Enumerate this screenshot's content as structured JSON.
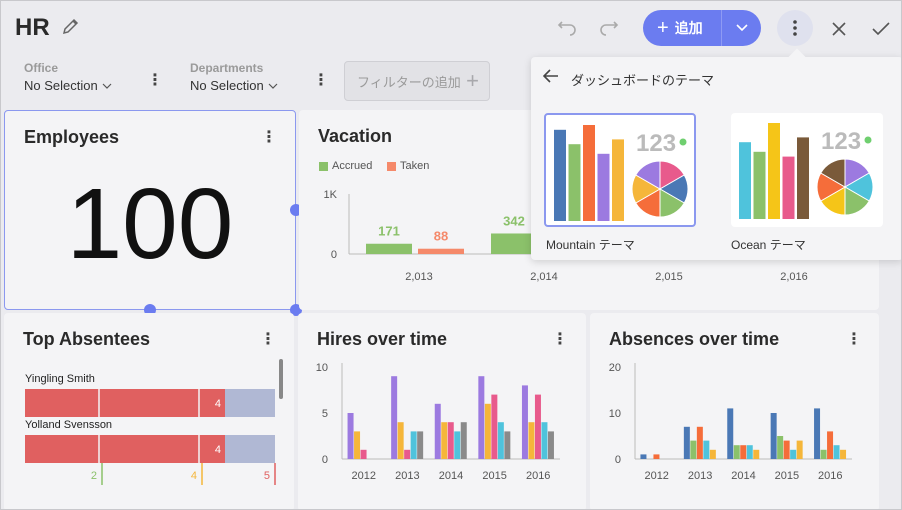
{
  "header": {
    "title": "HR",
    "add_label": "追加"
  },
  "filters": [
    {
      "label": "Office",
      "value": "No Selection"
    },
    {
      "label": "Departments",
      "value": "No Selection"
    }
  ],
  "add_filter_label": "フィルターの追加",
  "theme_popover": {
    "title": "ダッシュボードのテーマ",
    "themes": [
      {
        "name": "Mountain テーマ",
        "number": "123",
        "selected": true,
        "bar_colors": [
          "#4a78b5",
          "#8bc16a",
          "#f56d3a",
          "#9c7ae0",
          "#f5b63a"
        ],
        "bar_values": [
          0.95,
          0.8,
          1.0,
          0.7,
          0.85
        ],
        "pie_colors": [
          "#e85a8c",
          "#4a78b5",
          "#8bc16a",
          "#f56d3a",
          "#f5b63a",
          "#9c7ae0"
        ]
      },
      {
        "name": "Ocean テーマ",
        "number": "123",
        "selected": false,
        "bar_colors": [
          "#4fc3dc",
          "#8bc16a",
          "#f5c518",
          "#e85a8c",
          "#7a5a3a"
        ],
        "bar_values": [
          0.8,
          0.7,
          1.0,
          0.65,
          0.85
        ],
        "pie_colors": [
          "#9c7ae0",
          "#4fc3dc",
          "#8bc16a",
          "#f5c518",
          "#f56d3a",
          "#7a5a3a"
        ]
      }
    ]
  },
  "cards": {
    "employees": {
      "title": "Employees",
      "value": "100"
    },
    "vacation": {
      "title": "Vacation",
      "legend": [
        "Accrued",
        "Taken"
      ]
    },
    "top_absentees": {
      "title": "Top Absentees"
    },
    "hires": {
      "title": "Hires over time"
    },
    "absences": {
      "title": "Absences over time"
    }
  },
  "colors": {
    "accent": "#6b7cf0",
    "accrued": "#8bc16a",
    "taken": "#f5896a",
    "absentee_bar": "#e06060",
    "absentee_rest": "#b0b8d4"
  },
  "chart_data": [
    {
      "id": "vacation",
      "type": "bar",
      "categories": [
        "2,013",
        "2,014",
        "2,015",
        "2,016"
      ],
      "series": [
        {
          "name": "Accrued",
          "values": [
            171,
            342,
            null,
            null
          ]
        },
        {
          "name": "Taken",
          "values": [
            88,
            null,
            null,
            null
          ]
        }
      ],
      "yticks": [
        "1K",
        "0"
      ],
      "ylim": [
        0,
        1000
      ]
    },
    {
      "id": "top_absentees",
      "type": "bar",
      "orientation": "horizontal",
      "categories": [
        "Yingling Smith",
        "Yolland Svensson"
      ],
      "series": [
        {
          "values": [
            4,
            4
          ]
        }
      ],
      "scale_ticks": [
        "2",
        "4",
        "5"
      ],
      "scale_tick_colors": [
        "#8bc16a",
        "#f5b63a",
        "#e06060"
      ]
    },
    {
      "id": "hires",
      "type": "bar",
      "categories": [
        "2012",
        "2013",
        "2014",
        "2015",
        "2016"
      ],
      "yticks": [
        "10",
        "5",
        "0"
      ],
      "ylim": [
        0,
        10
      ],
      "series_colors": [
        "#9c7ae0",
        "#f5b63a",
        "#e85a8c",
        "#4fc3dc",
        "#8a8a8a"
      ],
      "series": [
        {
          "values": [
            5,
            9,
            6,
            9,
            8
          ]
        },
        {
          "values": [
            3,
            4,
            4,
            6,
            4
          ]
        },
        {
          "values": [
            1,
            1,
            4,
            7,
            7
          ]
        },
        {
          "values": [
            0,
            3,
            3,
            4,
            4
          ]
        },
        {
          "values": [
            0,
            3,
            4,
            3,
            3
          ]
        }
      ]
    },
    {
      "id": "absences",
      "type": "bar",
      "categories": [
        "2012",
        "2013",
        "2014",
        "2015",
        "2016"
      ],
      "yticks": [
        "20",
        "10",
        "0"
      ],
      "ylim": [
        0,
        20
      ],
      "series_colors": [
        "#4a78b5",
        "#8bc16a",
        "#f56d3a",
        "#4fc3dc",
        "#f5b63a"
      ],
      "series": [
        {
          "values": [
            1,
            7,
            11,
            10,
            11
          ]
        },
        {
          "values": [
            0,
            4,
            3,
            5,
            2
          ]
        },
        {
          "values": [
            1,
            7,
            3,
            4,
            6
          ]
        },
        {
          "values": [
            0,
            4,
            3,
            2,
            3
          ]
        },
        {
          "values": [
            0,
            2,
            2,
            4,
            2
          ]
        }
      ]
    }
  ]
}
